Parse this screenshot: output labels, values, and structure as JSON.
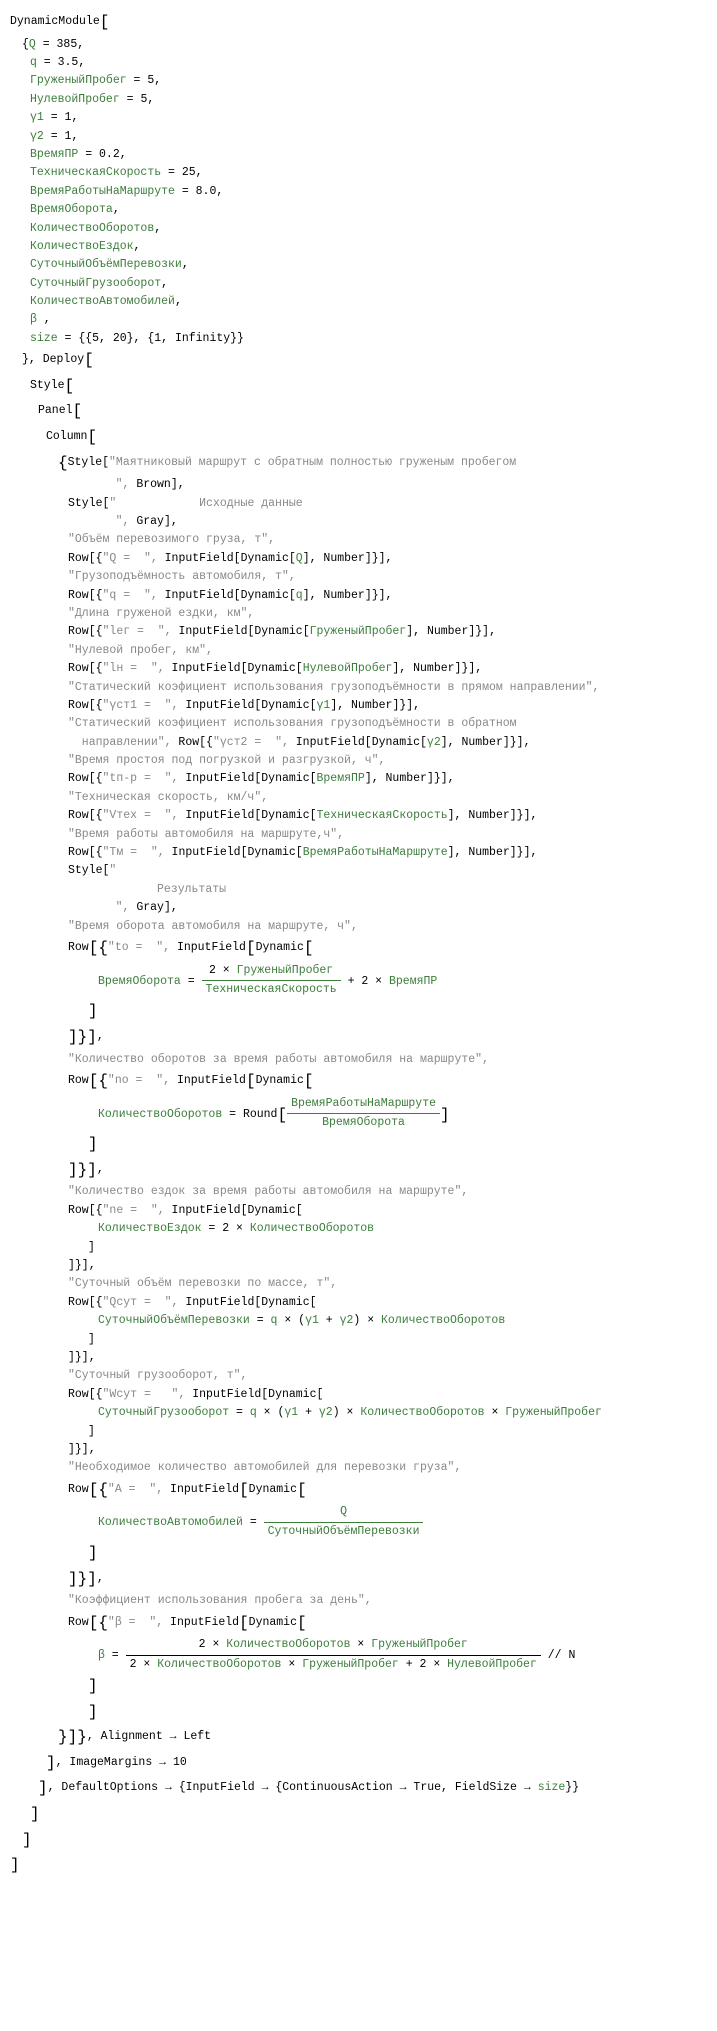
{
  "code": {
    "dynamicModule": "DynamicModule",
    "q_cap": "Q",
    "q_val": "385",
    "q_low": "q",
    "q_low_val": "3.5",
    "gruz": "ГруженыйПробег",
    "gruz_val": "5",
    "nul": "НулевойПробег",
    "nul_val": "5",
    "g1": "γ1",
    "g1_val": "1",
    "g2": "γ2",
    "g2_val": "1",
    "vpr": "ВремяПР",
    "vpr_val": "0.2",
    "tsk": "ТехническаяСкорость",
    "tsk_val": "25",
    "vrm": "ВремяРаботыНаМаршруте",
    "vrm_val": "8.0",
    "vob": "ВремяОборота",
    "kob": "КоличествоОборотов",
    "kez": "КоличествоЕздок",
    "sop": "СуточныйОбъёмПеревозки",
    "sgr": "СуточныйГрузооборот",
    "kav": "КоличествоАвтомобилей",
    "beta": "β",
    "size": "size",
    "size_val": "{{5, 20}, {1, Infinity}}",
    "deploy": "Deploy",
    "style": "Style",
    "panel": "Panel",
    "column": "Column",
    "row": "Row",
    "inputField": "InputField",
    "dynamic": "Dynamic",
    "number": "Number",
    "round": "Round",
    "alignment": "Alignment",
    "left": "Left",
    "imageMargins": "ImageMargins",
    "imageMargins_val": "10",
    "defaultOptions": "DefaultOptions",
    "continuousAction": "ContinuousAction",
    "true": "True",
    "fieldSize": "FieldSize",
    "brown": "Brown",
    "grayColor": "Gray",
    "nExpr": "N"
  },
  "strings": {
    "title": "\"Маятниковый маршрут с обратным полностью груженым пробегом",
    "closing_quote": "    \",",
    "input_header": "\"            Исходные данные",
    "input_header_close": "    \",",
    "s_objem": "\"Объём перевозимого груза, т\",",
    "s_q": "\"Q =  \", ",
    "s_gruzo": "\"Грузоподъёмность автомобиля, т\",",
    "s_qlow": "\"q =  \", ",
    "s_dlina": "\"Длина груженой ездки, км\",",
    "s_lr": "\"lег =  \", ",
    "s_nulprob": "\"Нулевой пробег, км\",",
    "s_ln": "\"lн =  \", ",
    "s_stat1": "\"Статический коэфициент использования грузоподъёмности в прямом направлении\",",
    "s_yst1": "\"γст1 =  \", ",
    "s_stat2": "\"Статический коэфициент использования грузоподъёмности в обратном",
    "s_stat2b": "  направлении\", ",
    "s_yst2": "\"γст2 =  \", ",
    "s_prostoi": "\"Время простоя под погрузкой и разгрузкой, ч\",",
    "s_tpr": "\"tп-p =  \", ",
    "s_texsp": "\"Техническая скорость, км/ч\",",
    "s_vtex": "\"Vтех =  \", ",
    "s_vrabm": "\"Время работы автомобиля на маршруте,ч\",",
    "s_tm": "\"Tм =  \", ",
    "results_header": "\"",
    "results_header2": "          Результаты",
    "results_header_close": "    \",",
    "s_vobor": "\"Время оборота автомобиля на маршруте, ч\",",
    "s_to": "\"tо =  \", ",
    "s_kobor": "\"Количество оборотов за время работы автомобиля на маршруте\",",
    "s_no": "\"nо =  \", ",
    "s_kezd": "\"Количество ездок за время работы автомобиля на маршруте\",",
    "s_ne": "\"nе =  \", ",
    "s_sobper": "\"Суточный объём перевозки по массе, т\",",
    "s_qsut": "\"Qсут =  \", ",
    "s_sgruz": "\"Суточный грузооборот, т\",",
    "s_wsut": "\"Wсут =   \", ",
    "s_nkol": "\"Необходимое количество автомобилей для перевозки груза\",",
    "s_a": "\"A =  \", ",
    "s_kip": "\"Коэффициент использования пробега за день\",",
    "s_beta": "\"β =  \", "
  }
}
